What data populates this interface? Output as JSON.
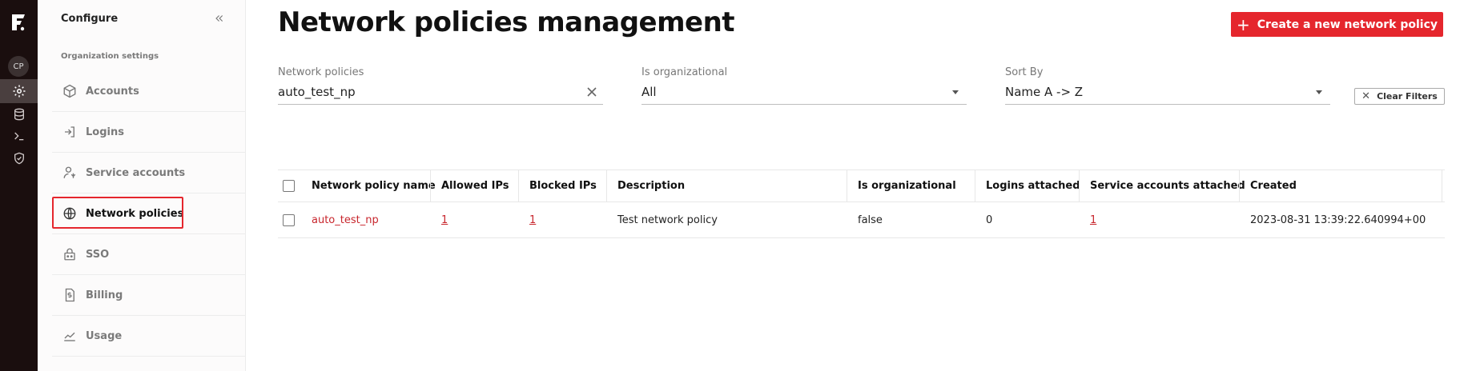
{
  "rail": {
    "avatar_initials": "CP",
    "items": [
      {
        "icon": "gear-icon",
        "active": true
      },
      {
        "icon": "database-icon",
        "active": false
      },
      {
        "icon": "terminal-icon",
        "active": false
      },
      {
        "icon": "shield-icon",
        "active": false
      }
    ]
  },
  "sidebar": {
    "title": "Configure",
    "section": "Organization settings",
    "items": [
      {
        "label": "Accounts",
        "icon": "cube-icon"
      },
      {
        "label": "Logins",
        "icon": "login-icon"
      },
      {
        "label": "Service accounts",
        "icon": "service-account-icon"
      },
      {
        "label": "Network policies",
        "icon": "globe-icon",
        "selected": true
      },
      {
        "label": "SSO",
        "icon": "sso-icon"
      },
      {
        "label": "Billing",
        "icon": "billing-icon"
      },
      {
        "label": "Usage",
        "icon": "usage-chart-icon"
      }
    ]
  },
  "header": {
    "title": "Network policies management",
    "create_button": "Create a new network policy"
  },
  "filters": {
    "network_policies": {
      "label": "Network policies",
      "value": "auto_test_np"
    },
    "is_organizational": {
      "label": "Is organizational",
      "value": "All"
    },
    "sort_by": {
      "label": "Sort By",
      "value": "Name A -> Z"
    },
    "clear_button": "Clear Filters"
  },
  "table": {
    "columns": [
      "Network policy name",
      "Allowed IPs",
      "Blocked IPs",
      "Description",
      "Is organizational",
      "Logins attached",
      "Service accounts attached",
      "Created"
    ],
    "rows": [
      {
        "name": "auto_test_np",
        "allowed_ips": "1",
        "blocked_ips": "1",
        "description": "Test network policy",
        "is_organizational": "false",
        "logins_attached": "0",
        "service_accounts_attached": "1",
        "created": "2023-08-31 13:39:22.640994+00"
      }
    ]
  },
  "colors": {
    "accent": "#e5262d",
    "rail": "#1a0e0e",
    "link": "#c8262d"
  }
}
